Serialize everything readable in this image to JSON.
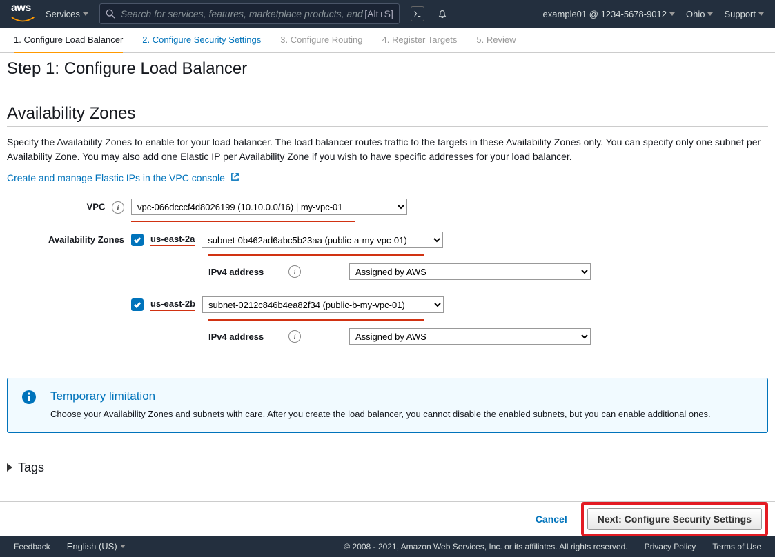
{
  "topnav": {
    "services": "Services",
    "search_placeholder": "Search for services, features, marketplace products, and",
    "search_shortcut": "[Alt+S]",
    "account": "example01 @ 1234-5678-9012",
    "region": "Ohio",
    "support": "Support"
  },
  "wizard": {
    "tabs": [
      "1. Configure Load Balancer",
      "2. Configure Security Settings",
      "3. Configure Routing",
      "4. Register Targets",
      "5. Review"
    ]
  },
  "page": {
    "step_title": "Step 1: Configure Load Balancer",
    "section_title": "Availability Zones",
    "section_desc": "Specify the Availability Zones to enable for your load balancer. The load balancer routes traffic to the targets in these Availability Zones only. You can specify only one subnet per Availability Zone. You may also add one Elastic IP per Availability Zone if you wish to have specific addresses for your load balancer.",
    "eip_link": "Create and manage Elastic IPs in the VPC console",
    "labels": {
      "vpc": "VPC",
      "az": "Availability Zones",
      "ipv4": "IPv4 address"
    },
    "vpc_value": "vpc-066dcccf4d8026199 (10.10.0.0/16) | my-vpc-01",
    "zones": [
      {
        "name": "us-east-2a",
        "subnet": "subnet-0b462ad6abc5b23aa (public-a-my-vpc-01)",
        "ipv4": "Assigned by AWS"
      },
      {
        "name": "us-east-2b",
        "subnet": "subnet-0212c846b4ea82f34 (public-b-my-vpc-01)",
        "ipv4": "Assigned by AWS"
      }
    ],
    "alert": {
      "title": "Temporary limitation",
      "body": "Choose your Availability Zones and subnets with care. After you create the load balancer, you cannot disable the enabled subnets, but you can enable additional ones."
    },
    "tags": "Tags"
  },
  "actions": {
    "cancel": "Cancel",
    "next": "Next: Configure Security Settings"
  },
  "footer": {
    "feedback": "Feedback",
    "language": "English (US)",
    "copyright": "© 2008 - 2021, Amazon Web Services, Inc. or its affiliates. All rights reserved.",
    "privacy": "Privacy Policy",
    "terms": "Terms of Use"
  }
}
